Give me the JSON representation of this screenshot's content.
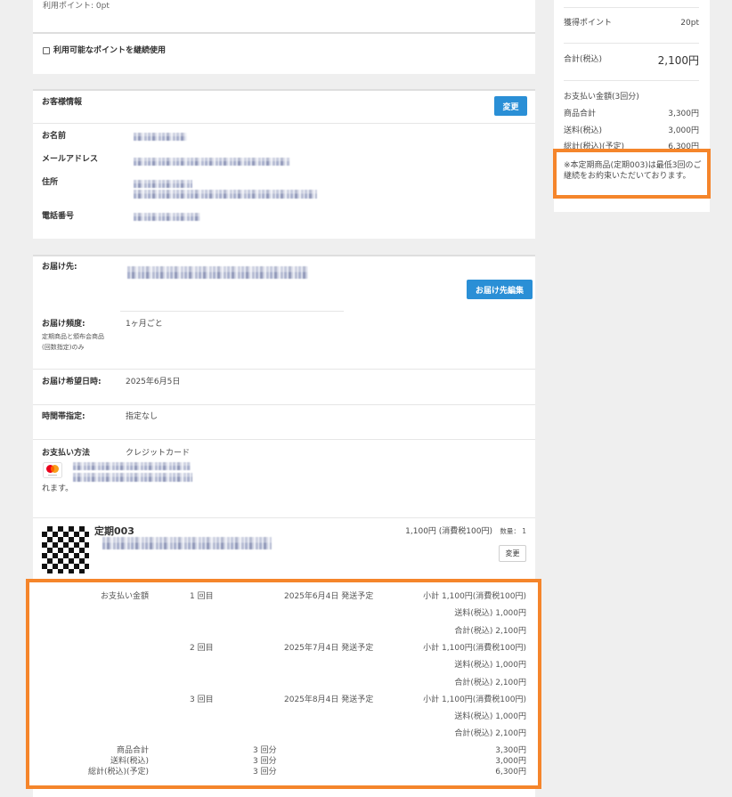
{
  "points": {
    "used_label": "利用ポイント: 0pt",
    "continue_label": "利用可能なポイントを継続使用",
    "continue_checked": false
  },
  "customer": {
    "title": "お客様情報",
    "change_button": "変更",
    "name_label": "お名前",
    "email_label": "メールアドレス",
    "address_label": "住所",
    "phone_label": "電話番号"
  },
  "delivery": {
    "address_label": "お届け先:",
    "edit_button": "お届け先編集",
    "frequency_label": "お届け頻度:",
    "frequency_note": [
      "定期商品と頒布会商品",
      "(回数指定)のみ"
    ],
    "frequency_value": "1ヶ月ごと",
    "date_label": "お届け希望日時:",
    "date_value": "2025年6月5日",
    "time_label": "時間帯指定:",
    "time_value": "指定なし",
    "payment_label": "お支払い方法",
    "payment_value": "クレジットカード",
    "payment_note_tail": "れます。",
    "card_brand_icon": "mastercard-icon"
  },
  "product": {
    "thumbnail_icon": "qr-code-thumbnail",
    "name": "定期003",
    "price": "1,100円 (消費税100円)",
    "quantity_label": "数量：",
    "quantity": "1",
    "change_button": "変更"
  },
  "schedule": {
    "label": "お支払い金額",
    "installments": [
      {
        "count": "1 回目",
        "ship_date": "2025年6月4日 発送予定",
        "subtotal": "小計 1,100円(消費税100円)",
        "shipping": "送料(税込) 1,000円",
        "total": "合計(税込) 2,100円"
      },
      {
        "count": "2 回目",
        "ship_date": "2025年7月4日 発送予定",
        "subtotal": "小計 1,100円(消費税100円)",
        "shipping": "送料(税込) 1,000円",
        "total": "合計(税込) 2,100円"
      },
      {
        "count": "3 回目",
        "ship_date": "2025年8月4日 発送予定",
        "subtotal": "小計 1,100円(消費税100円)",
        "shipping": "送料(税込) 1,000円",
        "total": "合計(税込) 2,100円"
      }
    ],
    "totals": [
      {
        "label": "商品合計",
        "times": "3 回分",
        "amount": "3,300円"
      },
      {
        "label": "送料(税込)",
        "times": "3 回分",
        "amount": "3,000円"
      },
      {
        "label": "総計(税込)(予定)",
        "times": "3 回分",
        "amount": "6,300円"
      }
    ]
  },
  "summary": {
    "points_label": "獲得ポイント",
    "points_value": "20pt",
    "total_label": "合計(税込)",
    "total_value": "2,100円",
    "payment_title": "お支払い金額(3回分)",
    "lines": [
      {
        "label": "商品合計",
        "value": "3,300円"
      },
      {
        "label": "送料(税込)",
        "value": "3,000円"
      },
      {
        "label": "総計(税込)(予定)",
        "value": "6,300円"
      }
    ],
    "note": [
      "※本定期商品(定期003)は最低3回のご",
      "継続をお約束いただいております。"
    ]
  },
  "colors": {
    "page_bg": "#efefef",
    "accent_blue": "#2a8fd6",
    "highlight_orange": "#f5852b"
  }
}
